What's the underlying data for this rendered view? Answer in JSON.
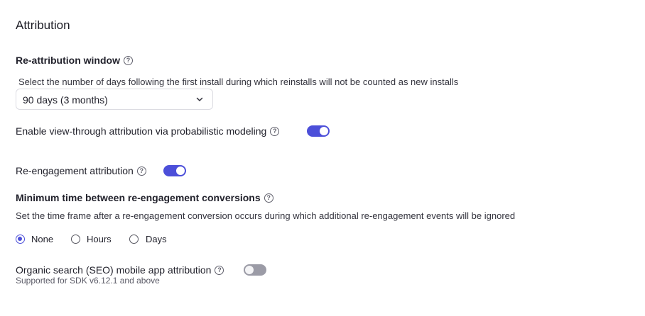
{
  "section": {
    "title": "Attribution"
  },
  "reattribution": {
    "label": "Re-attribution window",
    "description": "Select the number of days following the first install during which reinstalls will not be counted as new installs",
    "selected": "90 days (3 months)"
  },
  "view_through": {
    "label": "Enable view-through attribution via probabilistic modeling",
    "enabled": true
  },
  "reengagement": {
    "label": "Re-engagement attribution",
    "enabled": true
  },
  "min_time": {
    "label": "Minimum time between re-engagement conversions",
    "description": "Set the time frame after a re-engagement conversion occurs during which additional re-engagement events will be ignored",
    "options": [
      "None",
      "Hours",
      "Days"
    ],
    "selected": "None"
  },
  "seo": {
    "label": "Organic search (SEO) mobile app attribution",
    "note": "Supported for SDK v6.12.1 and above",
    "enabled": false
  },
  "icons": {
    "help": "help-circle-icon",
    "chevron": "chevron-down-icon"
  },
  "colors": {
    "accent": "#4c4fd9",
    "toggle_off": "#9b9ba6"
  }
}
